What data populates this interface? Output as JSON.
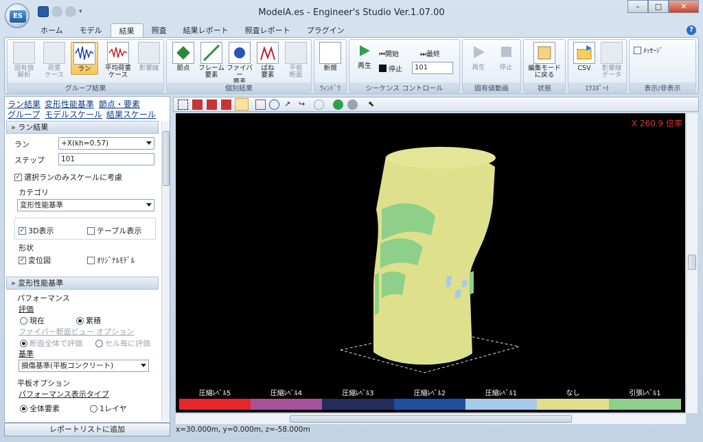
{
  "window": {
    "title": "ModelA.es - Engineer's Studio Ver.1.07.00",
    "logo_text": "ES",
    "min": "–",
    "max": "□",
    "close": "✕"
  },
  "tabs": [
    "ホーム",
    "モデル",
    "結果",
    "照査",
    "結果レポート",
    "照査レポート",
    "プラグイン"
  ],
  "active_tab": "結果",
  "ribbon": {
    "group_result": {
      "label": "グループ結果",
      "items": [
        "固有値\n解析",
        "荷重\nケース",
        "ラン",
        "平均荷重\nケース",
        "影響線"
      ]
    },
    "individual": {
      "label": "個別結果",
      "items": [
        "節点",
        "フレーム\n要素",
        "ファイバー\n要素",
        "ばね\n要素",
        "平板\n断面"
      ]
    },
    "window_group": {
      "label": "ｳｨﾝﾄﾞｳ",
      "new": "新規"
    },
    "sequence": {
      "label": "シーケンス コントロール",
      "play": "再生",
      "start": "開始",
      "stop": "停止",
      "last": "最終",
      "step": "101"
    },
    "eigen_anim": {
      "label": "固有値動画",
      "play": "再生",
      "stop": "停止"
    },
    "state": {
      "label": "状態",
      "back": "編集モード\nに戻る"
    },
    "export": {
      "label": "ｴｸｽﾎﾟｰﾄ",
      "csv": "CSV",
      "influence": "影響線\nデータ"
    },
    "display": {
      "label": "表示/非表示",
      "message": "ﾒｯｾｰｼﾞ"
    }
  },
  "left": {
    "links": [
      "ラン結果",
      "変形性能基準",
      "節点・要素",
      "グループ",
      "モデルスケール",
      "結果スケール"
    ],
    "run_section": "ラン結果",
    "run_label": "ラン",
    "run_value": "+X(kh=0.57)",
    "step_label": "ステップ",
    "step_value": "101",
    "scale_selected_only": "選択ランのみスケールに考慮",
    "category_label": "カテゴリ",
    "category_value": "変形性能基準",
    "display_3d": "3D表示",
    "display_table": "テーブル表示",
    "shape_label": "形状",
    "displacement": "変位図",
    "original_model": "ｵﾘｼﾞﾅﾙﾓﾃﾞﾙ",
    "criteria_section": "変形性能基準",
    "performance_label": "パフォーマンス",
    "evaluation_label": "評価",
    "eval_current": "現在",
    "eval_cumulative": "累積",
    "fiber_option": "ファイバー断面ビュー オプション",
    "whole_section": "断面全体で評価",
    "per_cell": "セル毎に評価",
    "criteria_label": "基準",
    "criteria_value": "損傷基準(平板コンクリート)",
    "plate_option": "平板オプション",
    "perf_display_type": "パフォーマンス表示タイプ",
    "all_elements": "全体要素",
    "one_layer": "1レイヤ",
    "report_button": "レポートリストに追加"
  },
  "viewport": {
    "scale_label": "X 260.9 倍率",
    "status": "x=30.000m, y=0.000m, z=-58.000m"
  },
  "legend": [
    {
      "label": "圧縮ﾚﾍﾞﾙ5",
      "color": "#e8262a"
    },
    {
      "label": "圧縮ﾚﾍﾞﾙ4",
      "color": "#a8509a"
    },
    {
      "label": "圧縮ﾚﾍﾞﾙ3",
      "color": "#232c5c"
    },
    {
      "label": "圧縮ﾚﾍﾞﾙ2",
      "color": "#1f4fa0"
    },
    {
      "label": "圧縮ﾚﾍﾞﾙ1",
      "color": "#a7c9ea"
    },
    {
      "label": "なし",
      "color": "#dfe08c"
    },
    {
      "label": "引張ﾚﾍﾞﾙ1",
      "color": "#8ed08a"
    }
  ]
}
